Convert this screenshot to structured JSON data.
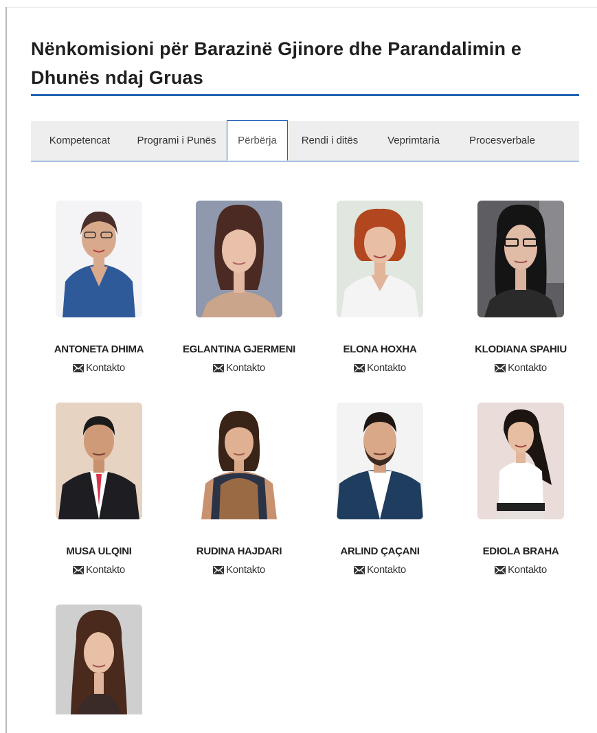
{
  "page": {
    "title": "Nënkomisioni për Barazinë Gjinore dhe Parandalimin e Dhunës ndaj Gruas"
  },
  "tabs": [
    {
      "label": "Kompetencat"
    },
    {
      "label": "Programi i Punës"
    },
    {
      "label": "Përbërja",
      "active": true
    },
    {
      "label": "Rendi i ditës"
    },
    {
      "label": "Veprimtaria"
    },
    {
      "label": "Procesverbale"
    }
  ],
  "contact_label": "Kontakto",
  "contact_icon": "envelope-icon",
  "members": [
    {
      "name": "ANTONETA DHIMA"
    },
    {
      "name": "EGLANTINA GJERMENI"
    },
    {
      "name": "ELONA HOXHA"
    },
    {
      "name": "KLODIANA SPAHIU"
    },
    {
      "name": "MUSA ULQINI"
    },
    {
      "name": "RUDINA HAJDARI"
    },
    {
      "name": "ARLIND ÇAÇANI"
    },
    {
      "name": "EDIOLA BRAHA"
    },
    {
      "name": ""
    }
  ],
  "colors": {
    "accent": "#1f63b3",
    "tab_bar": "#eeeeee"
  }
}
